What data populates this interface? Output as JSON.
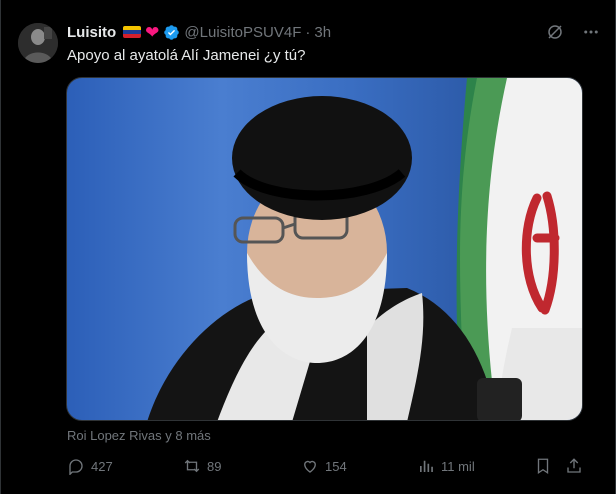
{
  "author": {
    "name": "Luisito",
    "handle": "@LuisitoPSUV4F",
    "separator": "·",
    "time": "3h"
  },
  "badges": {
    "flag": "venezuela-flag-icon",
    "heart": "❤",
    "verified": "verified-badge-icon"
  },
  "tweet": {
    "text": "Apoyo al ayatolá Alí Jamenei ¿y tú?"
  },
  "tagged": "Roi Lopez Rivas y 8 más",
  "actions": {
    "replies": "427",
    "reposts": "89",
    "likes": "154",
    "views": "11 mil"
  },
  "colors": {
    "background": "#000000",
    "text": "#e7e9ea",
    "muted": "#71767b",
    "verified": "#1d9bf0",
    "heart": "#f91880"
  }
}
